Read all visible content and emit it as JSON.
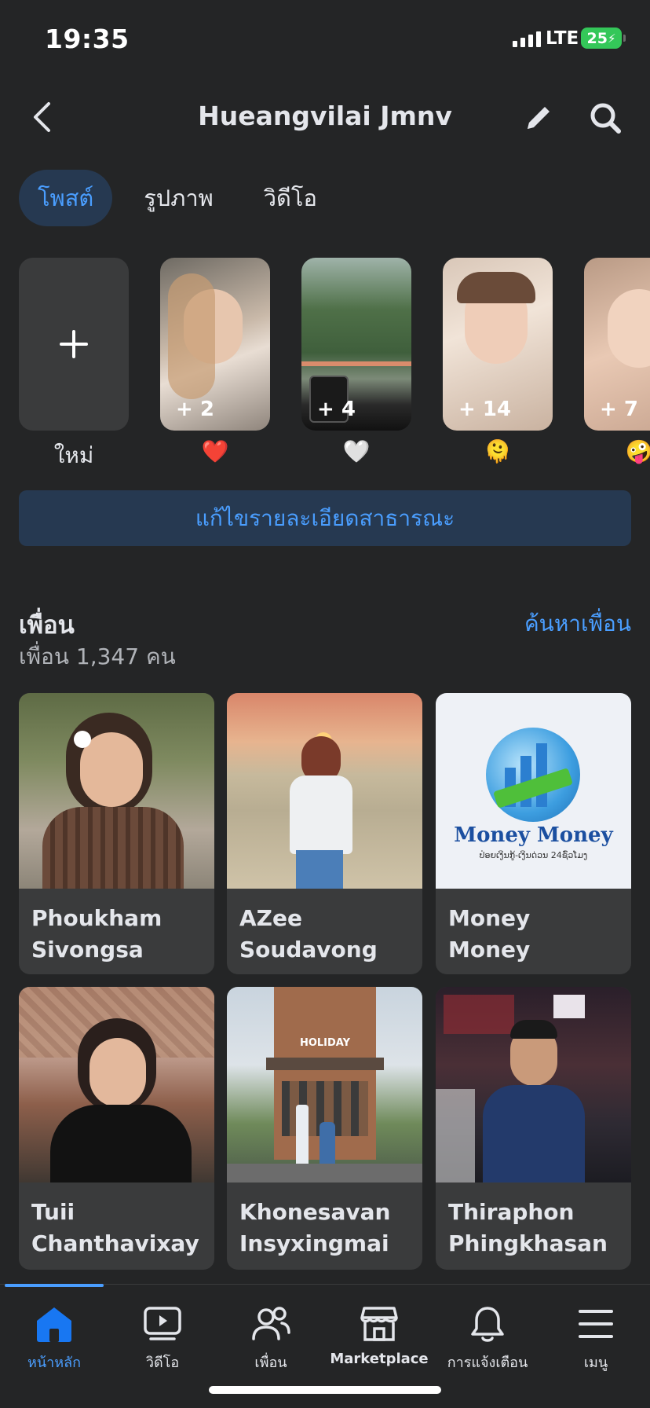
{
  "status_bar": {
    "time": "19:35",
    "network": "LTE",
    "battery": "25"
  },
  "header": {
    "title": "Hueangvilai Jmnv"
  },
  "tabs": [
    {
      "label": "โพสต์",
      "active": true
    },
    {
      "label": "รูปภาพ",
      "active": false
    },
    {
      "label": "วิดีโอ",
      "active": false
    }
  ],
  "highlights": {
    "new_label": "ใหม่",
    "items": [
      {
        "count": "+ 2",
        "emoji": "❤️"
      },
      {
        "count": "+ 4",
        "emoji": "🤍"
      },
      {
        "count": "+ 14",
        "emoji": "🫠"
      },
      {
        "count": "+ 7",
        "emoji": "🤪"
      }
    ]
  },
  "edit_public_details": "แก้ไขรายละเอียดสาธารณะ",
  "friends": {
    "title": "เพื่อน",
    "count_text": "เพื่อน 1,347 คน",
    "find_friends": "ค้นหาเพื่อน",
    "list": [
      {
        "name_line1": "Phoukham",
        "name_line2": "Sivongsa"
      },
      {
        "name_line1": "AZee",
        "name_line2": "Soudavong"
      },
      {
        "name_line1": "Money Money",
        "name_line2": ""
      },
      {
        "name_line1": "Tuii",
        "name_line2": "Chanthavixay"
      },
      {
        "name_line1": "Khonesavan",
        "name_line2": "Insyxingmai"
      },
      {
        "name_line1": "Thiraphon",
        "name_line2": "Phingkhasan"
      }
    ],
    "money_logo": {
      "title": "Money Money",
      "subtitle": "ປ່ອຍເງິນກູ້-ເງິນດ່ວນ 24ຊົ່ວໂມງ"
    },
    "holiday_sign": "HOLIDAY"
  },
  "bottom_nav": [
    {
      "label": "หน้าหลัก",
      "active": true
    },
    {
      "label": "วิดีโอ",
      "active": false
    },
    {
      "label": "เพื่อน",
      "active": false
    },
    {
      "label": "Marketplace",
      "active": false
    },
    {
      "label": "การแจ้งเตือน",
      "active": false
    },
    {
      "label": "เมนู",
      "active": false
    }
  ],
  "colors": {
    "background": "#242526",
    "card": "#3a3b3c",
    "accent": "#4a9eff",
    "accent_bg": "#263951"
  }
}
